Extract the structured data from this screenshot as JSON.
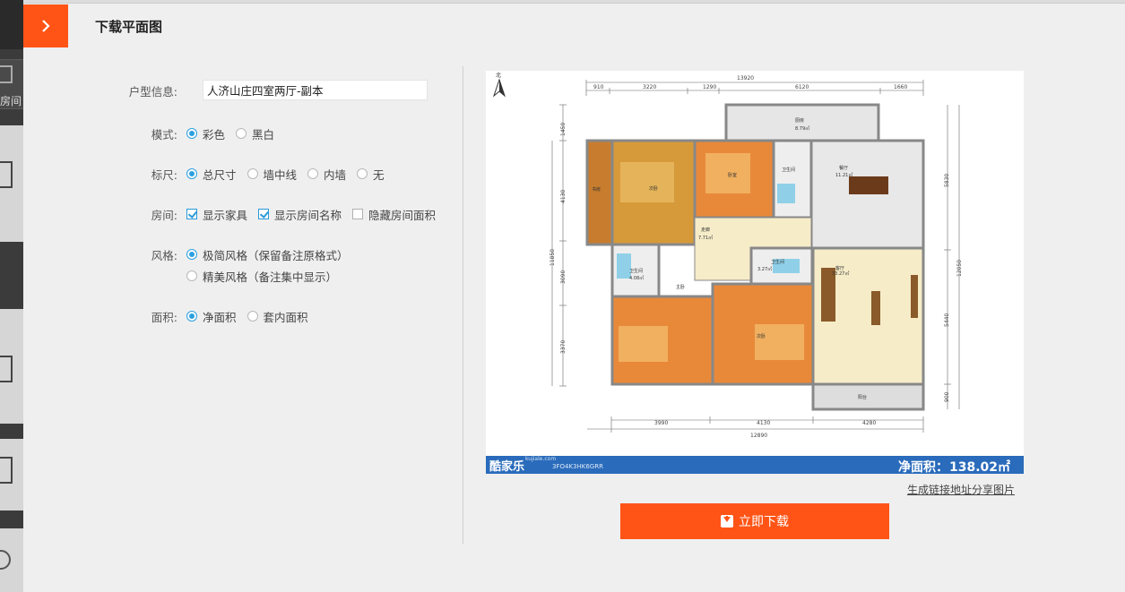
{
  "sidebar": {
    "partial_label": "房间"
  },
  "header": {
    "title": "下载平面图"
  },
  "form": {
    "house_info": {
      "label": "户型信息:",
      "value": "人济山庄四室两厅-副本"
    },
    "mode": {
      "label": "模式:",
      "options": [
        "彩色",
        "黑白"
      ],
      "selected": "彩色"
    },
    "ruler": {
      "label": "标尺:",
      "options": [
        "总尺寸",
        "墙中线",
        "内墙",
        "无"
      ],
      "selected": "总尺寸"
    },
    "room": {
      "label": "房间:",
      "options": [
        "显示家具",
        "显示房间名称",
        "隐藏房间面积"
      ],
      "checked": [
        "显示家具",
        "显示房间名称"
      ]
    },
    "style": {
      "label": "风格:",
      "options": [
        "极简风格（保留备注原格式）",
        "精美风格（备注集中显示）"
      ],
      "selected": "极简风格（保留备注原格式）"
    },
    "area": {
      "label": "面积:",
      "options": [
        "净面积",
        "套内面积"
      ],
      "selected": "净面积"
    }
  },
  "plan": {
    "north": "北",
    "dims_top_total": "13920",
    "dims_top": [
      "910",
      "3220",
      "1290",
      "6120",
      "1660"
    ],
    "dims_bottom": [
      "3990",
      "4130",
      "4280"
    ],
    "dims_bottom_total": "12890",
    "dims_left": [
      "1450",
      "4130",
      "3090",
      "3370"
    ],
    "dims_left_total": "11850",
    "dims_right": [
      "5830",
      "5440",
      "900"
    ],
    "dims_right_total": "12050",
    "rooms": {
      "kitchen": "厨房",
      "kitchen_area": "8.79㎡",
      "dining": "餐厅",
      "dining_area": "11.21㎡",
      "living": "客厅",
      "living_area": "33.27㎡",
      "corridor": "走廊",
      "corridor_area": "7.71㎡",
      "bath1": "卫生间",
      "bath1_area": "4.08㎡",
      "bath2": "卫生间",
      "bath2_area": "3.27㎡",
      "bath3": "卫生间",
      "bed_main": "主卧",
      "bed1": "次卧",
      "bed2": "次卧",
      "bed3": "卧室",
      "bed4": "书房",
      "balcony": "阳台"
    },
    "footer": {
      "logo": "酷家乐",
      "site": "kujiale.com",
      "code": "3FO4K3HK6GRR",
      "area_label": "净面积：",
      "area_value": "138.02㎡"
    }
  },
  "actions": {
    "share_link": "生成链接地址分享图片",
    "download": "立即下载"
  },
  "colors": {
    "accent": "#ff5416",
    "radio": "#2aa0e0",
    "footer_blue": "#2a6bbb"
  }
}
